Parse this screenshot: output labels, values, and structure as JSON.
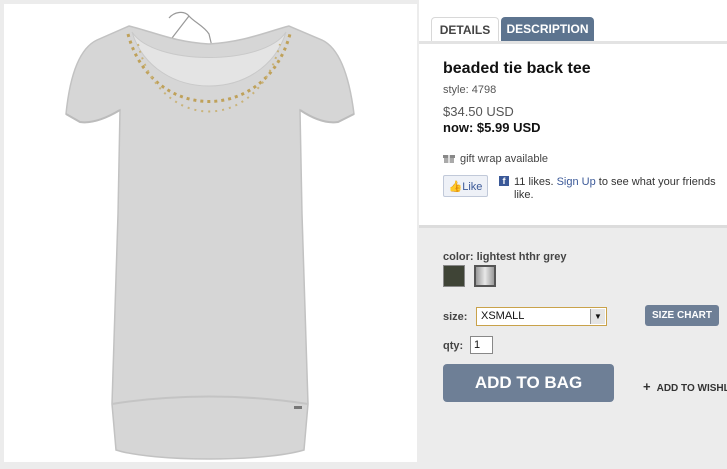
{
  "tabs": [
    {
      "label": "DETAILS"
    },
    {
      "label": "DESCRIPTION"
    }
  ],
  "product": {
    "title": "beaded tie back tee",
    "style": "style: 4798",
    "price_old": "$34.50 USD",
    "price_now": "now: $5.99 USD",
    "image_alt": "gray t-shirt product photo"
  },
  "gift": {
    "label": "gift wrap available",
    "icon": "gift-icon"
  },
  "facebook": {
    "like_label": "Like",
    "text_before": "11 likes. ",
    "signup_link": "Sign Up",
    "text_after": " to see what your friends like.",
    "icon": "f"
  },
  "options": {
    "color_label": "color: lightest hthr grey",
    "size_label": "size:",
    "size_value": "XSMALL",
    "size_chart_label": "SIZE CHART",
    "qty_label": "qty:",
    "qty_value": "1",
    "add_to_bag_label": "ADD TO BAG",
    "wishlist_label": "ADD TO WISHL"
  },
  "colors": {
    "tab_active_bg": "#5d748f",
    "button_bg": "#6e7f96",
    "facebook_blue": "#3b5998"
  }
}
